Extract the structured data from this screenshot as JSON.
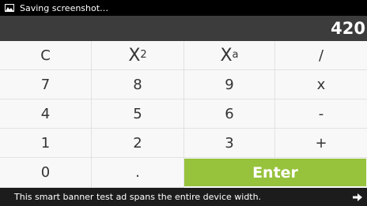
{
  "status_bar": {
    "text": "Saving screenshot…",
    "icon": "image-icon"
  },
  "display": {
    "value": "420"
  },
  "keys": {
    "clear": "C",
    "square_base": "X",
    "square_exp": "2",
    "power_base": "X",
    "power_exp": "a",
    "divide": "/",
    "seven": "7",
    "eight": "8",
    "nine": "9",
    "multiply": "x",
    "four": "4",
    "five": "5",
    "six": "6",
    "minus": "-",
    "one": "1",
    "two": "2",
    "three": "3",
    "plus": "+",
    "zero": "0",
    "decimal": ".",
    "enter": "Enter"
  },
  "ad_banner": {
    "text": "This smart banner test ad spans the entire device width.",
    "icon": "arrow-right-icon"
  },
  "colors": {
    "enter": "#97c23c",
    "display_bg": "#3c3c3c"
  }
}
